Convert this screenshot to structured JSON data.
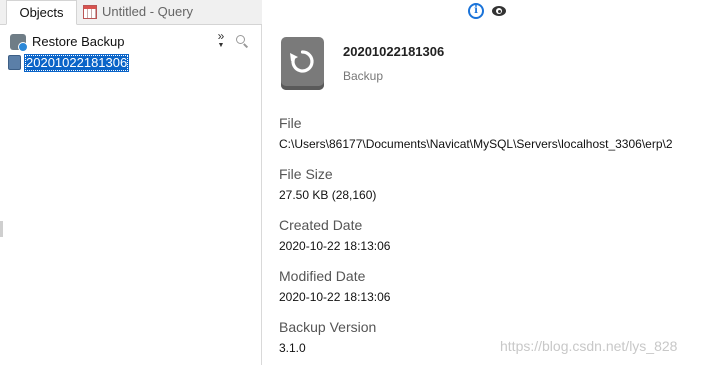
{
  "tabs": {
    "objects_label": "Objects",
    "query_label": "Untitled - Query"
  },
  "toolbar": {
    "restore_label": "Restore Backup",
    "more_label": "»"
  },
  "tree": {
    "items": [
      {
        "label": "20201022181306",
        "selected": true
      }
    ]
  },
  "details": {
    "title": "20201022181306",
    "subtitle": "Backup",
    "properties": [
      {
        "label": "File",
        "value": "C:\\Users\\86177\\Documents\\Navicat\\MySQL\\Servers\\localhost_3306\\erp\\2"
      },
      {
        "label": "File Size",
        "value": "27.50 KB (28,160)"
      },
      {
        "label": "Created Date",
        "value": "2020-10-22 18:13:06"
      },
      {
        "label": "Modified Date",
        "value": "2020-10-22 18:13:06"
      },
      {
        "label": "Backup Version",
        "value": "3.1.0"
      }
    ]
  },
  "header_icons": {
    "info": "info-icon",
    "view": "eye-icon"
  },
  "watermark": "https://blog.csdn.net/lys_828",
  "colors": {
    "selection": "#0a64c8",
    "info_accent": "#1a73d9",
    "backup_icon": "#7a7a7a"
  }
}
